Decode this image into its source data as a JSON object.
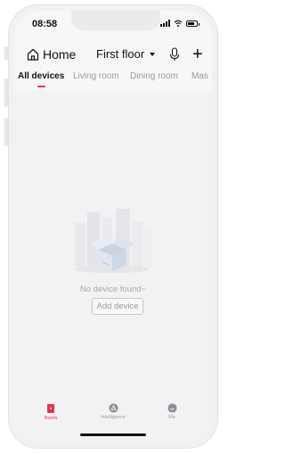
{
  "status_bar": {
    "time": "08:58"
  },
  "header": {
    "home_label": "Home",
    "floor_label": "First floor"
  },
  "tabs": [
    {
      "label": "All devices",
      "active": true
    },
    {
      "label": "Living room",
      "active": false
    },
    {
      "label": "Dining room",
      "active": false
    },
    {
      "label": "Mas",
      "active": false
    }
  ],
  "empty_state": {
    "message": "No device found~",
    "add_button_label": "Add device"
  },
  "bottom_nav": [
    {
      "label": "Room",
      "icon": "room-icon",
      "active": true
    },
    {
      "label": "Intelligence",
      "icon": "intelligence-icon",
      "active": false
    },
    {
      "label": "Me",
      "icon": "me-icon",
      "active": false
    }
  ],
  "colors": {
    "accent": "#e8344e",
    "background": "#f2f2f4",
    "header_bg": "#f7f7f7",
    "inactive_text": "#9a9a9a"
  }
}
